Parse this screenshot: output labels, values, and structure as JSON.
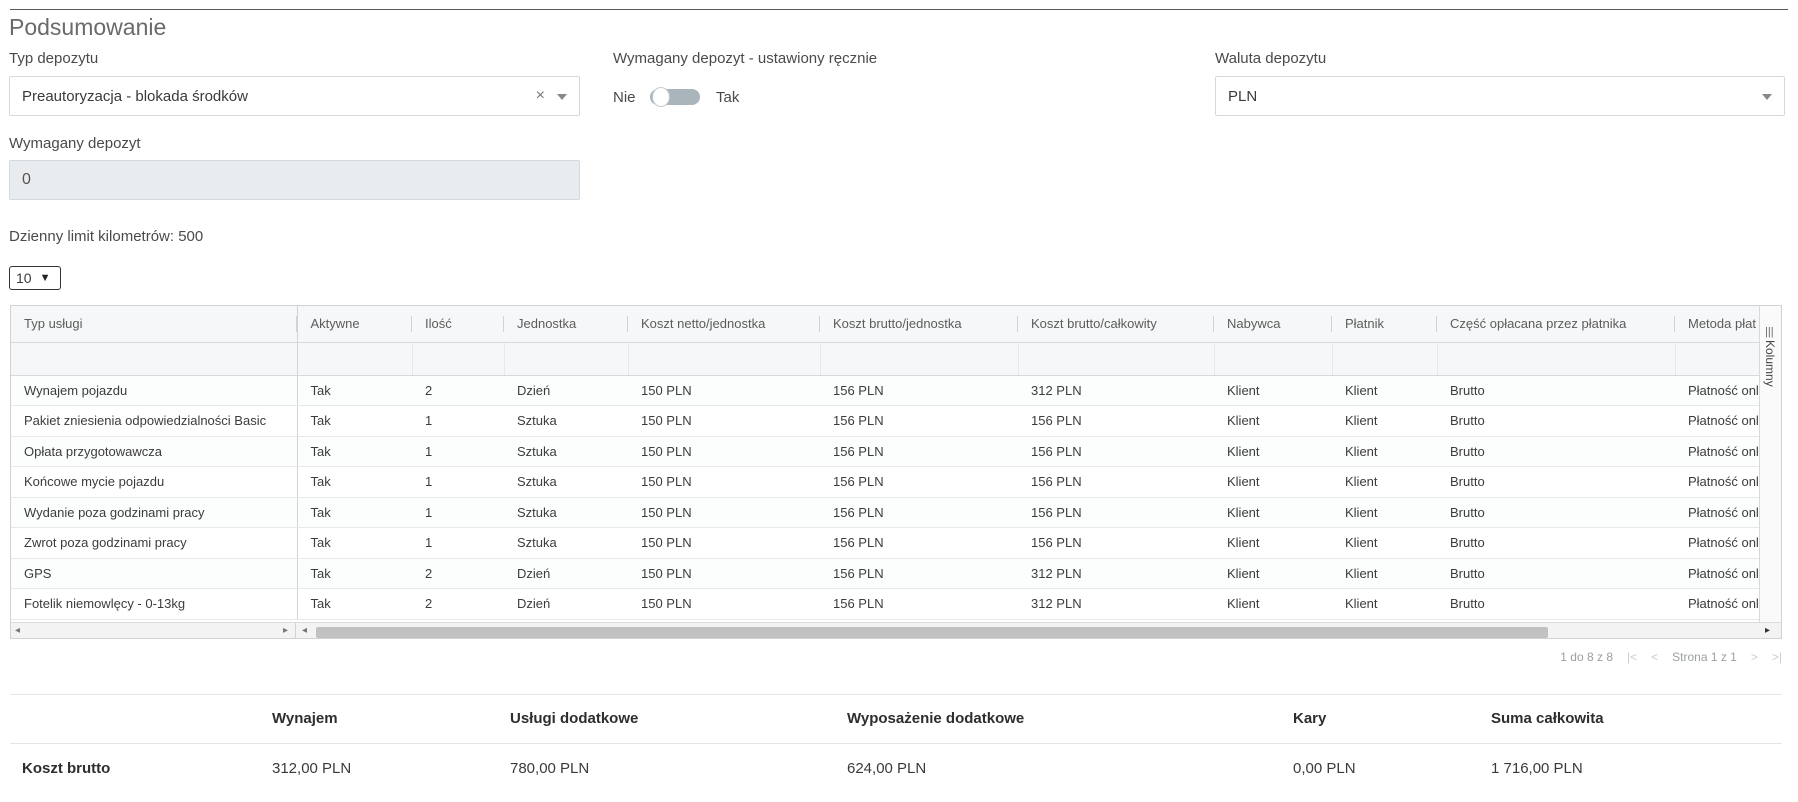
{
  "section": {
    "title": "Podsumowanie"
  },
  "deposit_type": {
    "label": "Typ depozytu",
    "value": "Preautoryzacja - blokada środków"
  },
  "manual_deposit": {
    "label": "Wymagany depozyt - ustawiony ręcznie",
    "off_label": "Nie",
    "on_label": "Tak",
    "enabled": false
  },
  "currency": {
    "label": "Waluta depozytu",
    "value": "PLN"
  },
  "required_deposit": {
    "label": "Wymagany depozyt",
    "value": "0"
  },
  "km_limit": {
    "text": "Dzienny limit kilometrów: 500"
  },
  "page_size": {
    "value": "10"
  },
  "table": {
    "columns": [
      "Typ usługi",
      "Aktywne",
      "Ilość",
      "Jednostka",
      "Koszt netto/jednostka",
      "Koszt brutto/jednostka",
      "Koszt brutto/całkowity",
      "Nabywca",
      "Płatnik",
      "Część opłacana przez płatnika",
      "Metoda płat"
    ],
    "rows": [
      [
        "Wynajem pojazdu",
        "Tak",
        "2",
        "Dzień",
        "150 PLN",
        "156 PLN",
        "312 PLN",
        "Klient",
        "Klient",
        "Brutto",
        "Płatność onli"
      ],
      [
        "Pakiet zniesienia odpowiedzialności Basic",
        "Tak",
        "1",
        "Sztuka",
        "150 PLN",
        "156 PLN",
        "156 PLN",
        "Klient",
        "Klient",
        "Brutto",
        "Płatność onli"
      ],
      [
        "Opłata przygotowawcza",
        "Tak",
        "1",
        "Sztuka",
        "150 PLN",
        "156 PLN",
        "156 PLN",
        "Klient",
        "Klient",
        "Brutto",
        "Płatność onli"
      ],
      [
        "Końcowe mycie pojazdu",
        "Tak",
        "1",
        "Sztuka",
        "150 PLN",
        "156 PLN",
        "156 PLN",
        "Klient",
        "Klient",
        "Brutto",
        "Płatność onli"
      ],
      [
        "Wydanie poza godzinami pracy",
        "Tak",
        "1",
        "Sztuka",
        "150 PLN",
        "156 PLN",
        "156 PLN",
        "Klient",
        "Klient",
        "Brutto",
        "Płatność onli"
      ],
      [
        "Zwrot poza godzinami pracy",
        "Tak",
        "1",
        "Sztuka",
        "150 PLN",
        "156 PLN",
        "156 PLN",
        "Klient",
        "Klient",
        "Brutto",
        "Płatność onli"
      ],
      [
        "GPS",
        "Tak",
        "2",
        "Dzień",
        "150 PLN",
        "156 PLN",
        "312 PLN",
        "Klient",
        "Klient",
        "Brutto",
        "Płatność onli"
      ],
      [
        "Fotelik niemowlęcy - 0-13kg",
        "Tak",
        "2",
        "Dzień",
        "150 PLN",
        "156 PLN",
        "312 PLN",
        "Klient",
        "Klient",
        "Brutto",
        "Płatność onli"
      ]
    ],
    "columns_tab": "Kolumny"
  },
  "pager": {
    "range": "1 do 8 z 8",
    "page": "Strona 1 z 1"
  },
  "summary": {
    "headers": [
      "Wynajem",
      "Usługi dodatkowe",
      "Wyposażenie dodatkowe",
      "Kary",
      "Suma całkowita"
    ],
    "row_label": "Koszt brutto",
    "values": [
      "312,00 PLN",
      "780,00 PLN",
      "624,00 PLN",
      "0,00 PLN",
      "1 716,00 PLN"
    ]
  }
}
